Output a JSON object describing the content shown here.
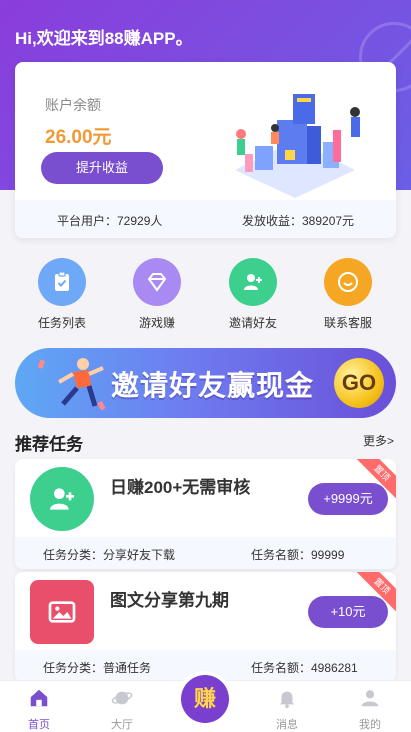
{
  "header": {
    "greeting": "Hi,欢迎来到88赚APP。"
  },
  "balance": {
    "label": "账户余额",
    "amount": "26.00元",
    "withdraw_label": "提升收益",
    "stats": {
      "users": "平台用户：72929人",
      "payout": "发放收益：389207元"
    }
  },
  "quick_nav": [
    {
      "label": "任务列表",
      "icon": "clipboard-icon",
      "color": "#6fa8f6"
    },
    {
      "label": "游戏赚",
      "icon": "diamond-icon",
      "color": "#a98af3"
    },
    {
      "label": "邀请好友",
      "icon": "add-user-icon",
      "color": "#3ccf8e"
    },
    {
      "label": "联系客服",
      "icon": "smile-icon",
      "color": "#f5a623"
    }
  ],
  "banner": {
    "text": "邀请好友赢现金",
    "go_label": "GO"
  },
  "recommended": {
    "title": "推荐任务",
    "more_label": "更多>",
    "tasks": [
      {
        "title": "日赚200+无需审核",
        "reward": "+9999元",
        "ribbon": "置顶",
        "category": "任务分类：分享好友下载",
        "quota": "任务名额：99999",
        "icon": "add-user-icon",
        "icon_color": "#3ccf8e"
      },
      {
        "title": "图文分享第九期",
        "reward": "+10元",
        "ribbon": "置顶",
        "category": "任务分类：普通任务",
        "quota": "任务名额：4986281",
        "icon": "image-icon",
        "icon_color": "#e94f6b"
      }
    ]
  },
  "tabbar": {
    "items": [
      {
        "label": "首页",
        "icon": "home-icon",
        "active": true
      },
      {
        "label": "大厅",
        "icon": "planet-icon",
        "active": false
      },
      {
        "label": "赚",
        "icon": "earn-icon",
        "active": false
      },
      {
        "label": "消息",
        "icon": "bell-icon",
        "active": false
      },
      {
        "label": "我的",
        "icon": "user-icon",
        "active": false
      }
    ]
  },
  "colors": {
    "primary": "#7a4fcf",
    "accent": "#f09a35",
    "ribbon": "#ff6b6b"
  }
}
